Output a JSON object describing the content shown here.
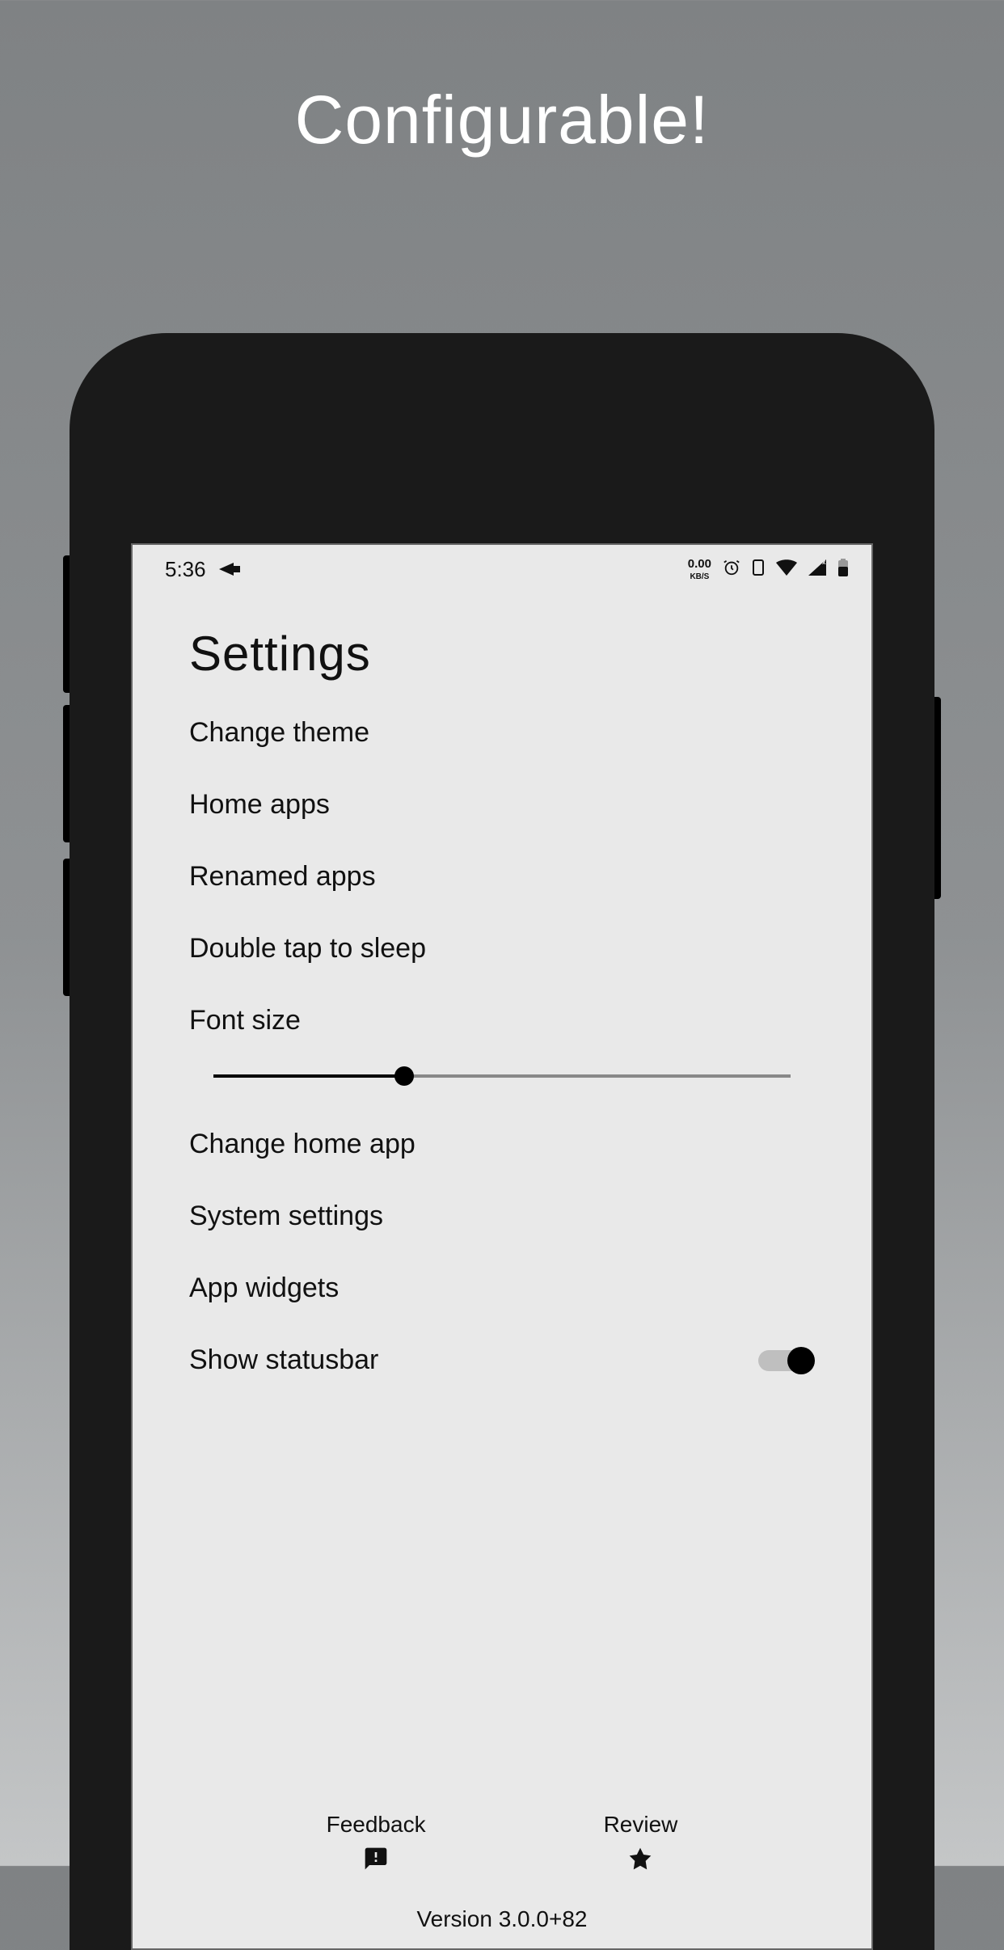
{
  "headline": "Configurable!",
  "status_bar": {
    "time": "5:36",
    "speed_value": "0.00",
    "speed_unit": "KB/S"
  },
  "settings": {
    "title": "Settings",
    "items": {
      "change_theme": "Change theme",
      "home_apps": "Home apps",
      "renamed_apps": "Renamed apps",
      "double_tap": "Double tap to sleep",
      "font_size": "Font size",
      "change_home_app": "Change home app",
      "system_settings": "System settings",
      "app_widgets": "App widgets",
      "show_statusbar": "Show statusbar"
    },
    "font_slider_percent": 33,
    "show_statusbar_on": true
  },
  "footer": {
    "feedback": "Feedback",
    "review": "Review",
    "version": "Version 3.0.0+82"
  }
}
